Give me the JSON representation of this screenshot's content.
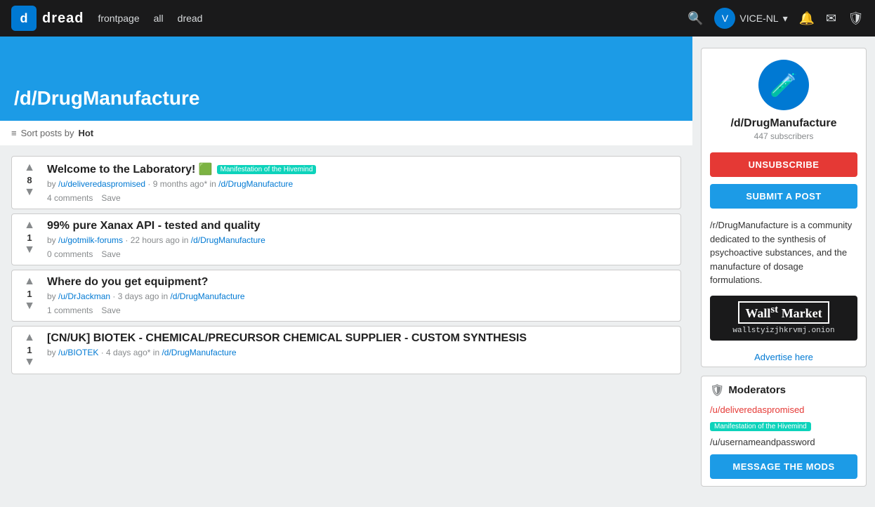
{
  "header": {
    "logo_letter": "d",
    "logo_text": "dread",
    "nav": [
      {
        "label": "frontpage",
        "id": "frontpage"
      },
      {
        "label": "all",
        "id": "all"
      },
      {
        "label": "dread",
        "id": "dread"
      }
    ],
    "username": "VICE-NL"
  },
  "subreddit": {
    "name": "/d/DrugManufacture",
    "subscribers": "447 subscribers",
    "icon_symbol": "🧪",
    "description": "/r/DrugManufacture is a community dedicated to the synthesis of psychoactive substances, and the manufacture of dosage formulations.",
    "ad": {
      "title": "Wall",
      "st": "st",
      "market": "Market",
      "url": "wallstyizjhkrvmj.onion"
    },
    "advertise_label": "Advertise here",
    "moderators_title": "Moderators",
    "mod1": "/u/deliveredaspromised",
    "mod1_flair": "Manifestation of the Hivemind",
    "mod2": "/u/usernameandpassword",
    "btn_unsubscribe": "UNSUBSCRIBE",
    "btn_submit": "SUBMIT A POST",
    "btn_message_mods": "MESSAGE THE MODS"
  },
  "sort": {
    "label": "Sort posts by",
    "current": "Hot"
  },
  "posts": [
    {
      "id": "post1",
      "score": "8",
      "title": "Welcome to the Laboratory! 🟩",
      "has_flair": true,
      "flair_text": "Manifestation of the Hivemind",
      "author": "/u/deliveredaspromised",
      "time": "9 months ago*",
      "sub": "/d/DrugManufacture",
      "comments": "4 comments",
      "save": "Save"
    },
    {
      "id": "post2",
      "score": "1",
      "title": "99% pure Xanax API - tested and quality",
      "has_flair": false,
      "flair_text": "",
      "author": "/u/gotmilk-forums",
      "time": "22 hours ago",
      "sub": "/d/DrugManufacture",
      "comments": "0 comments",
      "save": "Save"
    },
    {
      "id": "post3",
      "score": "1",
      "title": "Where do you get equipment?",
      "has_flair": false,
      "flair_text": "",
      "author": "/u/DrJackman",
      "time": "3 days ago",
      "sub": "/d/DrugManufacture",
      "comments": "1 comments",
      "save": "Save"
    },
    {
      "id": "post4",
      "score": "1",
      "title": "[CN/UK] BIOTEK - CHEMICAL/PRECURSOR CHEMICAL SUPPLIER - CUSTOM SYNTHESIS",
      "has_flair": false,
      "flair_text": "",
      "author": "/u/BIOTEK",
      "time": "4 days ago*",
      "sub": "/d/DrugManufacture",
      "comments": "",
      "save": ""
    }
  ]
}
